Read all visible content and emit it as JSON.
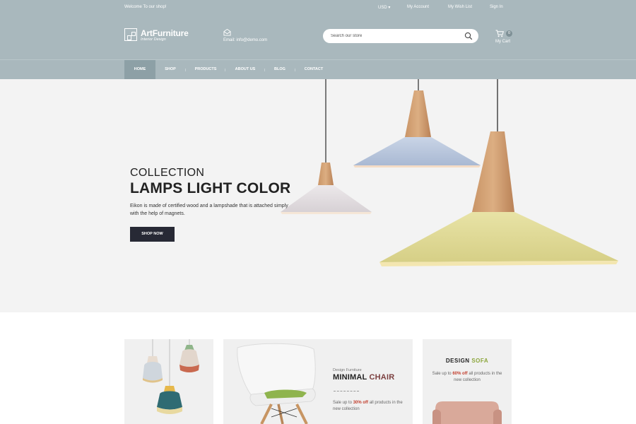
{
  "topbar": {
    "welcome": "Welcome To our shop!",
    "currency": "USD ▾",
    "my_account": "My Account",
    "wishlist": "My Wish List",
    "sign_in": "Sign In"
  },
  "logo": {
    "name": "ArtFurniture",
    "tagline": "Interior Design"
  },
  "contact": {
    "email": "Email: info@demo.com",
    "icon": "email-icon"
  },
  "search": {
    "placeholder": "Search our store",
    "icon": "search-icon"
  },
  "cart": {
    "count": "0",
    "label": "My Cart",
    "icon": "cart-icon"
  },
  "nav": {
    "items": [
      "HOME",
      "SHOP",
      "PRODUCTS",
      "ABOUT US",
      "BLOG",
      "CONTACT"
    ],
    "active": "HOME"
  },
  "hero": {
    "subtitle": "COLLECTION",
    "title": "LAMPS LIGHT COLOR",
    "description": "Eikon is made of certified wood and a lampshade that is attached simply with the help of magnets.",
    "button": "SHOP NOW"
  },
  "banners": {
    "chair": {
      "small": "Design Furniture",
      "title_main": "MINIMAL ",
      "title_accent": "CHAIR",
      "desc_pre": "Sale up to ",
      "desc_highlight": "30% off",
      "desc_post": " all products in the new collection"
    },
    "sofa": {
      "title_main": "DESIGN ",
      "title_accent": "SOFA",
      "desc_pre": "Sale up to ",
      "desc_highlight": "60% off",
      "desc_post": " all products in the new collection"
    }
  },
  "colors": {
    "header_bg": "#a9b8bd",
    "nav_active": "#8da0a6",
    "hero_bg": "#f3f3f3",
    "button_dark": "#272935",
    "accent_red": "#c2402f",
    "accent_green": "#8ca63c",
    "accent_brown": "#7b3f3f"
  }
}
